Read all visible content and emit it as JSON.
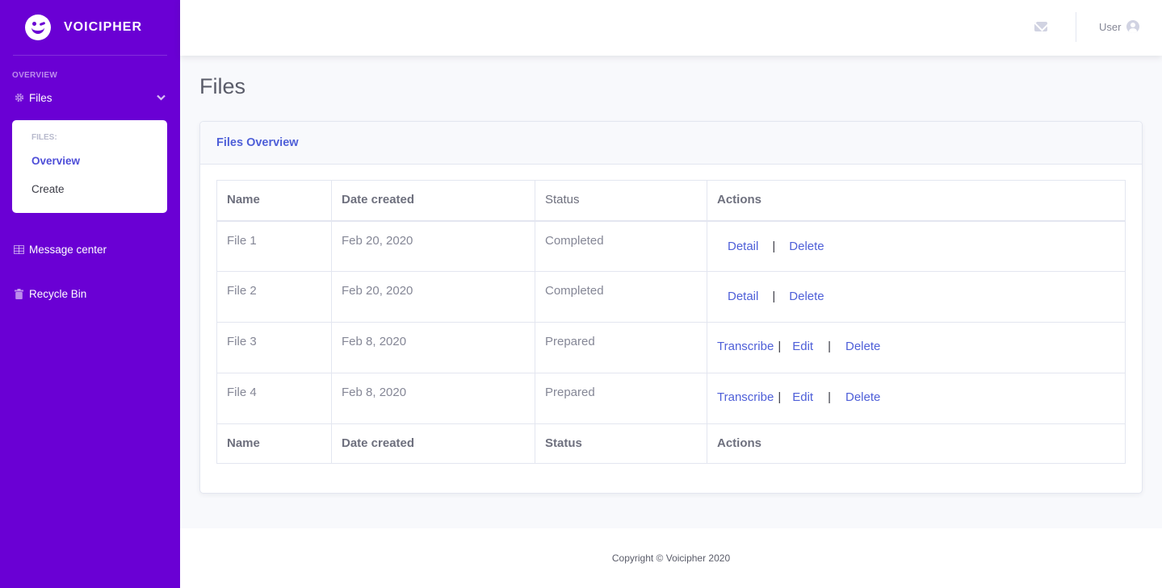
{
  "brand": {
    "name": "VOICIPHER",
    "logo_icon": "smiley-wink-icon"
  },
  "sidebar": {
    "heading": "OVERVIEW",
    "files": {
      "label": "Files",
      "icon": "gear-icon",
      "chevron": "chevron-down-icon"
    },
    "submenu": {
      "header": "FILES:",
      "items": [
        "Overview",
        "Create"
      ],
      "active": "Overview"
    },
    "message_center": {
      "label": "Message center",
      "icon": "table-icon"
    },
    "recycle_bin": {
      "label": "Recycle Bin",
      "icon": "trash-icon"
    },
    "color": "#6a00d4"
  },
  "topbar": {
    "mail_icon": "envelope-icon",
    "user_label": "User",
    "user_icon": "user-circle-icon"
  },
  "page": {
    "title": "Files"
  },
  "card": {
    "title": "Files Overview"
  },
  "table": {
    "headers": [
      "Name",
      "Date created",
      "Status",
      "Actions"
    ],
    "rows": [
      {
        "name": "File 1",
        "date": "Feb 20, 2020",
        "status": "Completed",
        "actions": [
          "Detail",
          "Delete"
        ]
      },
      {
        "name": "File 2",
        "date": "Feb 20, 2020",
        "status": "Completed",
        "actions": [
          "Detail",
          "Delete"
        ]
      },
      {
        "name": "File 3",
        "date": "Feb 8, 2020",
        "status": "Prepared",
        "actions": [
          "Transcribe",
          "Edit",
          "Delete"
        ]
      },
      {
        "name": "File 4",
        "date": "Feb 8, 2020",
        "status": "Prepared",
        "actions": [
          "Transcribe",
          "Edit",
          "Delete"
        ]
      }
    ],
    "footers": [
      "Name",
      "Date created",
      "Status",
      "Actions"
    ],
    "separator": "|"
  },
  "footer": {
    "copyright": "Copyright © Voicipher 2020"
  },
  "colors": {
    "link": "#4e5fd8",
    "text": "#858796"
  }
}
